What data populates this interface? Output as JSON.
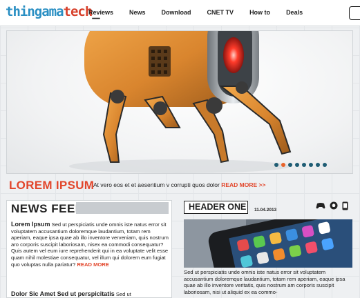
{
  "header": {
    "logo_part1": "thingama",
    "logo_part2": "tech",
    "logo_part3": "_",
    "nav": [
      "Reviews",
      "News",
      "Download",
      "CNET TV",
      "How to",
      "Deals"
    ]
  },
  "hero": {
    "title": "LOREM IPSUM",
    "text": "At vero eos et et aesentium v corrupti quos dolor",
    "read_more": "READ MORE >>",
    "slides_count": 8,
    "active_slide": 1
  },
  "feed": {
    "title": "NEWS FEED",
    "item1_title": "Lorem Ipsum",
    "item1_text": "Sed ut perspiciatis unde omnis iste natus error sit voluptatem accusantium doloremque laudantium, totam rem aperiam, eaque ipsa quae ab illo inventore verveniam, quis nostrum aro corporis suscipit laboriosam, nisex ea commodi consequatur? Quis autem vel eum iure reprehenderit qui in ea voluptate velit esse quam nihil molestiae consequatur, vel illum qui dolorem eum fugiat quo voluptas nulla pariatur?",
    "item1_more": "READ MORE",
    "item2_title": "Dolor Sic Amet Sed ut perspicitatis",
    "item2_text": "Sed ut"
  },
  "featured": {
    "title": "HEADER ONE",
    "date": "11.04.2013",
    "text": "Sed ut perspiciatis unde omnis iste natus error sit voluptatem accusantium doloremque laudantium, totam rem aperiam, eaque ipsa quae ab illo inventore veritatis, quis nostrum am corporis suscipit laboriosam, nisi ut aliquid ex ea commo-"
  },
  "icons": [
    "gamepad-icon",
    "soccer-ball-icon",
    "phone-icon"
  ],
  "colors": {
    "accent": "#e2462b",
    "brand_blue": "#2a8fc3",
    "dot": "#1f5d74",
    "dot_active": "#e8632a"
  }
}
